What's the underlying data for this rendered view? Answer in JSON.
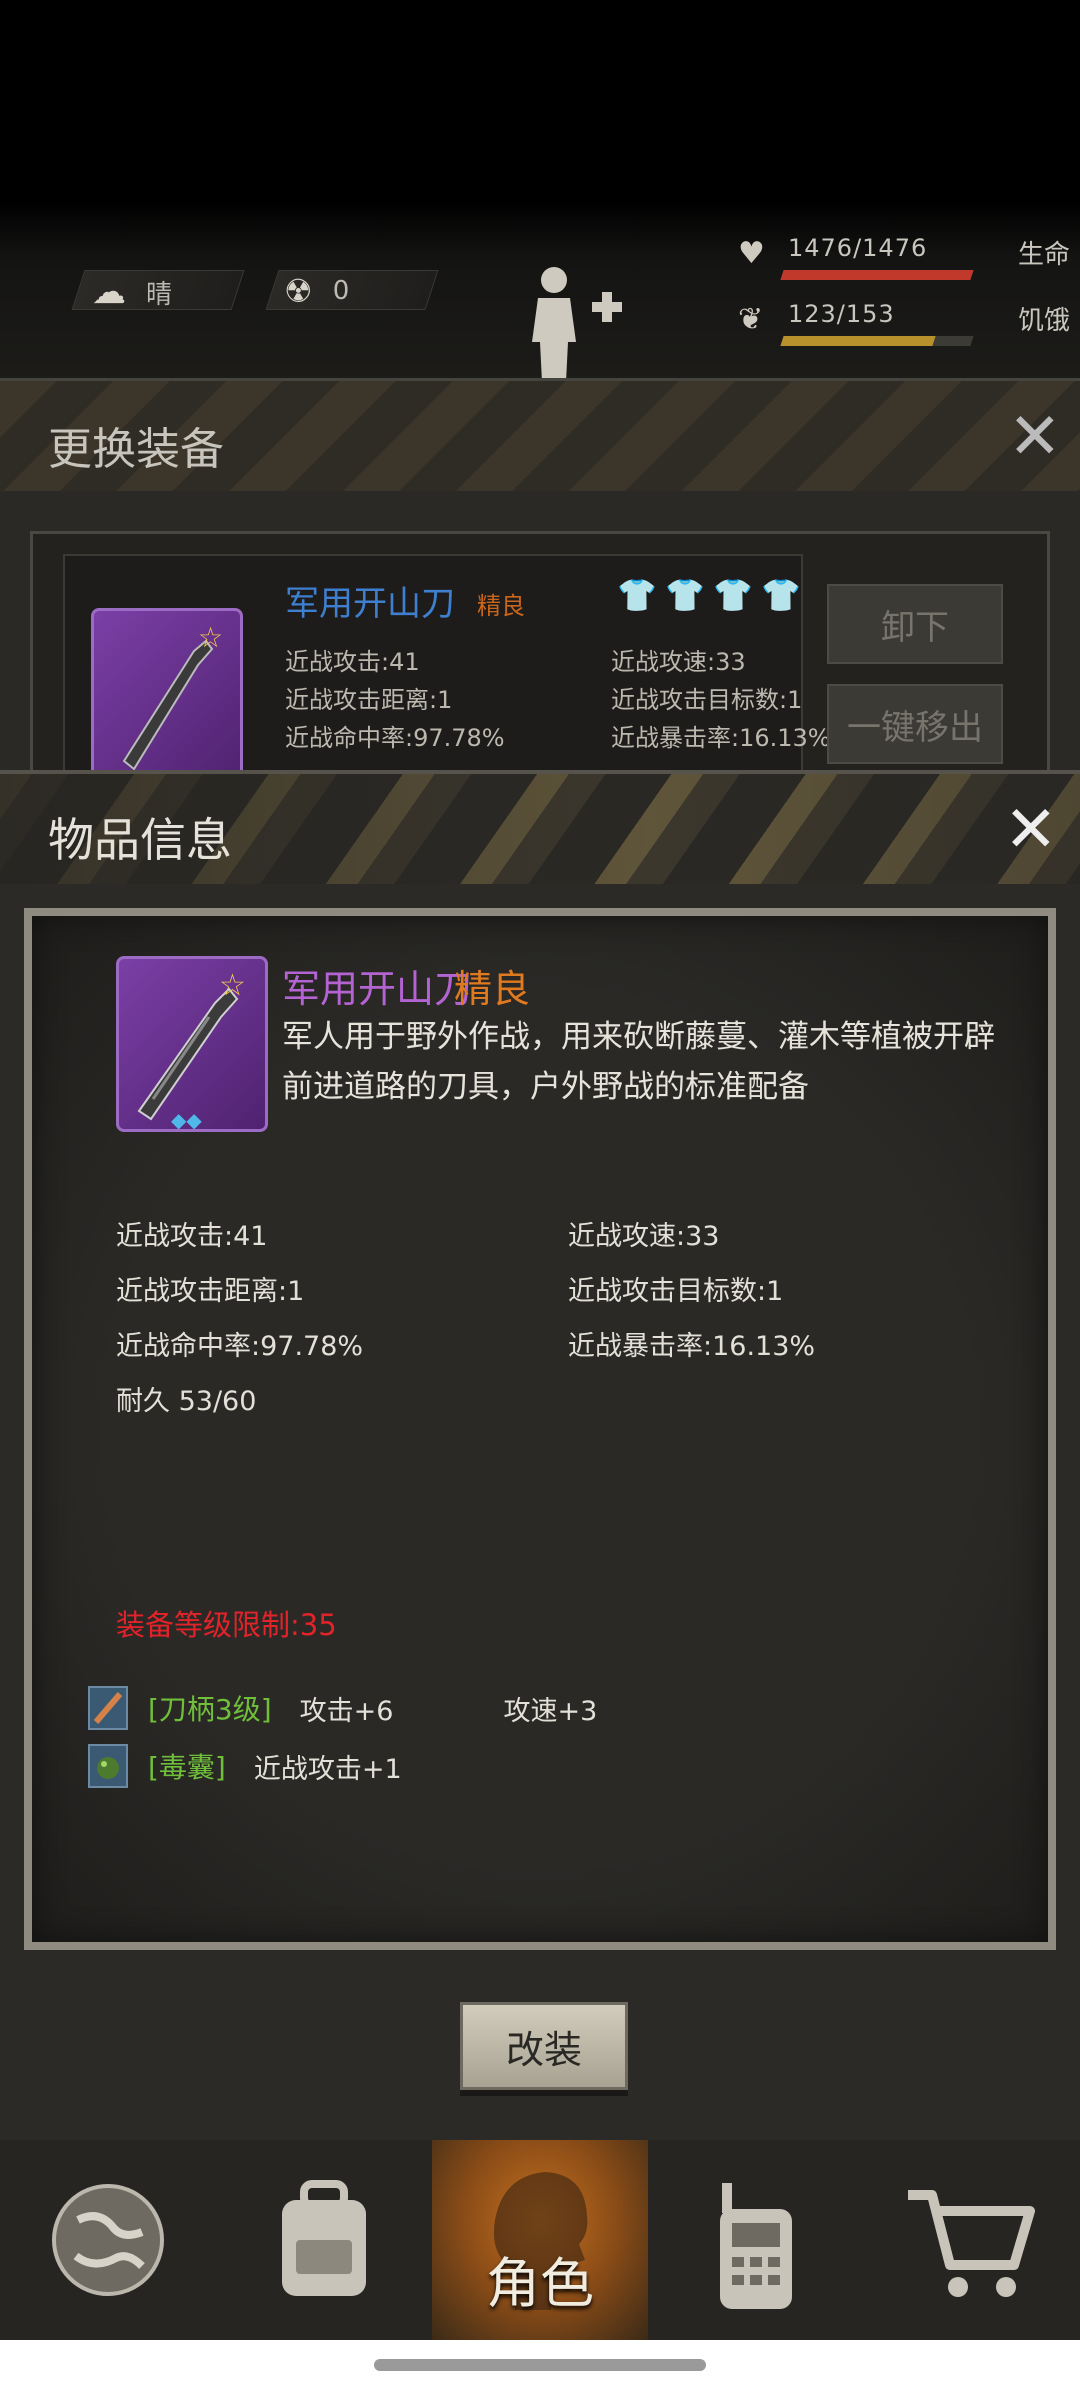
{
  "status": {
    "weather_label": "晴",
    "radiation_value": "0",
    "health_value": "1476/1476",
    "health_label": "生命",
    "health_fill": 1.0,
    "hunger_value": "123/153",
    "hunger_label": "饥饿",
    "hunger_fill": 0.8
  },
  "equip_dialog": {
    "title": "更换装备",
    "item_name": "军用开山刀",
    "item_quality": "精良",
    "stats": [
      "近战攻击:41",
      "近战攻速:33",
      "近战攻击距离:1",
      "近战攻击目标数:1",
      "近战命中率:97.78%",
      "近战暴击率:16.13%"
    ],
    "unequip_label": "卸下",
    "remove_all_label": "一键移出"
  },
  "item_info": {
    "title": "物品信息",
    "item_name": "军用开山刀",
    "item_quality": "精良",
    "description": "军人用于野外作战，用来砍断藤蔓、灌木等植被开辟前进道路的刀具，户外野战的标准配备",
    "stats": [
      "近战攻击:41",
      "近战攻速:33",
      "近战攻击距离:1",
      "近战攻击目标数:1",
      "近战命中率:97.78%",
      "近战暴击率:16.13%"
    ],
    "durability": "耐久 53/60",
    "level_limit": "装备等级限制:35",
    "mods": [
      {
        "name": "[刀柄3级]",
        "effects": [
          "攻击+6",
          "攻速+3"
        ]
      },
      {
        "name": "[毒囊]",
        "effects": [
          "近战攻击+1"
        ]
      }
    ],
    "modify_label": "改装"
  },
  "bottom_nav": {
    "active_label": "角色"
  },
  "colors": {
    "accent_purple": "#b463d2",
    "quality_orange": "#e07a20",
    "limit_red": "#e3232a",
    "mod_green": "#6fbf3b",
    "equip_name_blue": "#3f7fd0"
  }
}
